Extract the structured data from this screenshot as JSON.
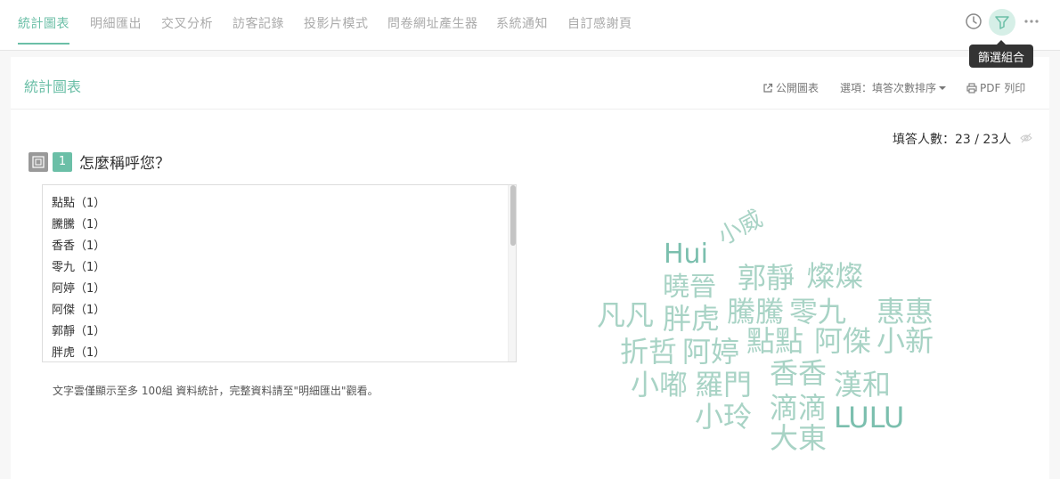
{
  "tabs": [
    {
      "label": "統計圖表"
    },
    {
      "label": "明細匯出"
    },
    {
      "label": "交叉分析"
    },
    {
      "label": "訪客記錄"
    },
    {
      "label": "投影片模式"
    },
    {
      "label": "問卷網址產生器"
    },
    {
      "label": "系統通知"
    },
    {
      "label": "自訂感謝頁"
    }
  ],
  "toolbar": {
    "history_icon": "clock-icon",
    "filter_icon": "filter-icon",
    "more_icon": "more-icon",
    "tooltip": "篩選組合"
  },
  "panel": {
    "title": "統計圖表",
    "actions": {
      "public_chart": "公開圖表",
      "options": "選項：填答次數排序",
      "pdf_print": "PDF 列印"
    },
    "respondents": "填答人數：23 / 23人"
  },
  "question": {
    "number": "1",
    "text": "怎麼稱呼您？",
    "answers": [
      "點點（1）",
      "騰騰（1）",
      "香香（1）",
      "零九（1）",
      "阿婷（1）",
      "阿傑（1）",
      "郭靜（1）",
      "胖虎（1）"
    ],
    "note": "文字雲僅顯示至多 100組 資料統計，完整資料請至\"明細匯出\"觀看。"
  },
  "word_cloud": [
    {
      "text": "Hui",
      "strong": true
    },
    {
      "text": "小威",
      "strong": false
    },
    {
      "text": "郭靜",
      "strong": false
    },
    {
      "text": "燦燦",
      "strong": false
    },
    {
      "text": "曉晉",
      "strong": false
    },
    {
      "text": "凡凡",
      "strong": false
    },
    {
      "text": "胖虎",
      "strong": false
    },
    {
      "text": "騰騰",
      "strong": false
    },
    {
      "text": "零九",
      "strong": false
    },
    {
      "text": "惠惠",
      "strong": false
    },
    {
      "text": "折哲",
      "strong": false
    },
    {
      "text": "阿婷",
      "strong": false
    },
    {
      "text": "點點",
      "strong": false
    },
    {
      "text": "阿傑",
      "strong": false
    },
    {
      "text": "小新",
      "strong": false
    },
    {
      "text": "香香",
      "strong": false
    },
    {
      "text": "小嘟",
      "strong": false
    },
    {
      "text": "羅門",
      "strong": false
    },
    {
      "text": "漢和",
      "strong": false
    },
    {
      "text": "滴滴",
      "strong": false
    },
    {
      "text": "小玲",
      "strong": false
    },
    {
      "text": "LULU",
      "strong": true
    },
    {
      "text": "大東",
      "strong": false
    }
  ]
}
